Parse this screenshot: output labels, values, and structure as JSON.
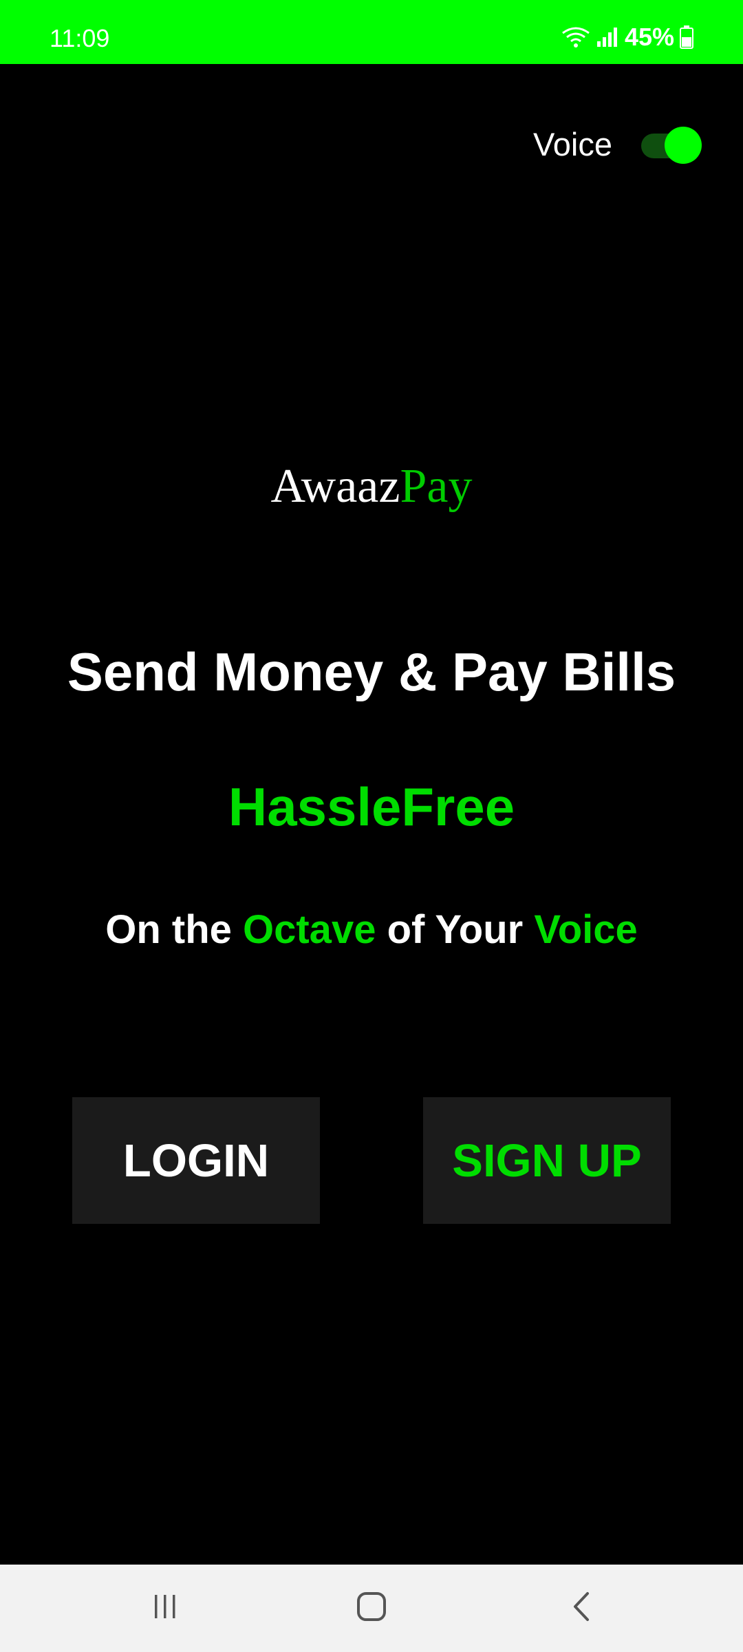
{
  "status_bar": {
    "time": "11:09",
    "battery": "45%",
    "background_color": "#00FF00",
    "icons": [
      "wifi-icon",
      "signal-icon",
      "battery-icon"
    ]
  },
  "voice_toggle": {
    "label": "Voice",
    "on": true
  },
  "logo": {
    "part1": "Awaaz",
    "part2": "Pay"
  },
  "headline": "Send Money & Pay Bills",
  "subheadline": "HassleFree",
  "tagline": {
    "part1": "On the ",
    "part2": "Octave",
    "part3": " of Your ",
    "part4": "Voice"
  },
  "buttons": {
    "login": "LOGIN",
    "signup": "SIGN UP"
  },
  "nav_bar": {
    "icons": [
      "recent-apps-icon",
      "home-icon",
      "back-icon"
    ]
  },
  "colors": {
    "accent": "#00DD00",
    "background": "#000000",
    "button_bg": "#1b1b1b"
  }
}
